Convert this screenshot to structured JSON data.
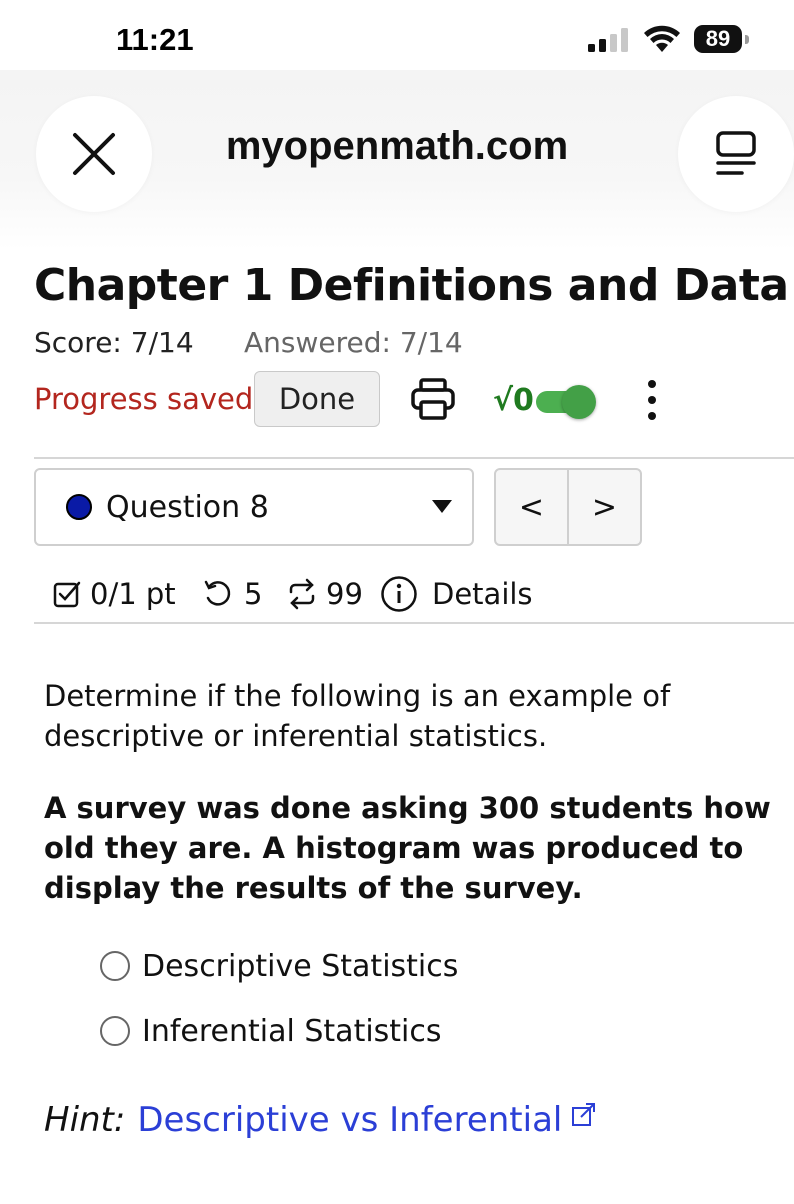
{
  "status_bar": {
    "time": "11:21",
    "battery": "89"
  },
  "browser": {
    "url": "myopenmath.com",
    "close_icon": "close-icon",
    "menu_icon": "tabs-icon"
  },
  "assessment": {
    "title": "Chapter 1 Definitions and Data",
    "score": "Score: 7/14",
    "answered": "Answered: 7/14",
    "progress": "Progress saved",
    "done_label": "Done",
    "math_label": "√0",
    "math_toggle_on": true
  },
  "question_nav": {
    "selected": "Question 8",
    "status_color": "#0a1aa6",
    "prev": "<",
    "next": ">"
  },
  "question_meta": {
    "points": "0/1 pt",
    "retries": "5",
    "regens": "99",
    "details": "Details"
  },
  "question": {
    "prompt": "Determine if the following is an example of descriptive or inferential statistics.",
    "stem": "A survey was done asking 300 students how old they are. A histogram was produced to display the results of the survey.",
    "options": [
      "Descriptive Statistics",
      "Inferential Statistics"
    ],
    "hint_label": "Hint:",
    "hint_link": "Descriptive vs Inferential"
  },
  "colors": {
    "saved": "#b3261e",
    "link": "#2b3fd6",
    "toggle": "#43a047"
  }
}
